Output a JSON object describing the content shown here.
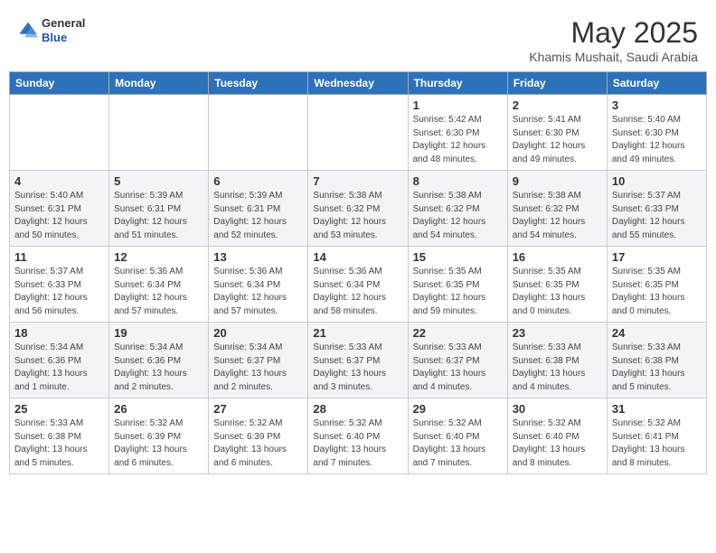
{
  "header": {
    "logo_general": "General",
    "logo_blue": "Blue",
    "month": "May 2025",
    "location": "Khamis Mushait, Saudi Arabia"
  },
  "weekdays": [
    "Sunday",
    "Monday",
    "Tuesday",
    "Wednesday",
    "Thursday",
    "Friday",
    "Saturday"
  ],
  "weeks": [
    [
      {
        "day": "",
        "info": ""
      },
      {
        "day": "",
        "info": ""
      },
      {
        "day": "",
        "info": ""
      },
      {
        "day": "",
        "info": ""
      },
      {
        "day": "1",
        "info": "Sunrise: 5:42 AM\nSunset: 6:30 PM\nDaylight: 12 hours\nand 48 minutes."
      },
      {
        "day": "2",
        "info": "Sunrise: 5:41 AM\nSunset: 6:30 PM\nDaylight: 12 hours\nand 49 minutes."
      },
      {
        "day": "3",
        "info": "Sunrise: 5:40 AM\nSunset: 6:30 PM\nDaylight: 12 hours\nand 49 minutes."
      }
    ],
    [
      {
        "day": "4",
        "info": "Sunrise: 5:40 AM\nSunset: 6:31 PM\nDaylight: 12 hours\nand 50 minutes."
      },
      {
        "day": "5",
        "info": "Sunrise: 5:39 AM\nSunset: 6:31 PM\nDaylight: 12 hours\nand 51 minutes."
      },
      {
        "day": "6",
        "info": "Sunrise: 5:39 AM\nSunset: 6:31 PM\nDaylight: 12 hours\nand 52 minutes."
      },
      {
        "day": "7",
        "info": "Sunrise: 5:38 AM\nSunset: 6:32 PM\nDaylight: 12 hours\nand 53 minutes."
      },
      {
        "day": "8",
        "info": "Sunrise: 5:38 AM\nSunset: 6:32 PM\nDaylight: 12 hours\nand 54 minutes."
      },
      {
        "day": "9",
        "info": "Sunrise: 5:38 AM\nSunset: 6:32 PM\nDaylight: 12 hours\nand 54 minutes."
      },
      {
        "day": "10",
        "info": "Sunrise: 5:37 AM\nSunset: 6:33 PM\nDaylight: 12 hours\nand 55 minutes."
      }
    ],
    [
      {
        "day": "11",
        "info": "Sunrise: 5:37 AM\nSunset: 6:33 PM\nDaylight: 12 hours\nand 56 minutes."
      },
      {
        "day": "12",
        "info": "Sunrise: 5:36 AM\nSunset: 6:34 PM\nDaylight: 12 hours\nand 57 minutes."
      },
      {
        "day": "13",
        "info": "Sunrise: 5:36 AM\nSunset: 6:34 PM\nDaylight: 12 hours\nand 57 minutes."
      },
      {
        "day": "14",
        "info": "Sunrise: 5:36 AM\nSunset: 6:34 PM\nDaylight: 12 hours\nand 58 minutes."
      },
      {
        "day": "15",
        "info": "Sunrise: 5:35 AM\nSunset: 6:35 PM\nDaylight: 12 hours\nand 59 minutes."
      },
      {
        "day": "16",
        "info": "Sunrise: 5:35 AM\nSunset: 6:35 PM\nDaylight: 13 hours\nand 0 minutes."
      },
      {
        "day": "17",
        "info": "Sunrise: 5:35 AM\nSunset: 6:35 PM\nDaylight: 13 hours\nand 0 minutes."
      }
    ],
    [
      {
        "day": "18",
        "info": "Sunrise: 5:34 AM\nSunset: 6:36 PM\nDaylight: 13 hours\nand 1 minute."
      },
      {
        "day": "19",
        "info": "Sunrise: 5:34 AM\nSunset: 6:36 PM\nDaylight: 13 hours\nand 2 minutes."
      },
      {
        "day": "20",
        "info": "Sunrise: 5:34 AM\nSunset: 6:37 PM\nDaylight: 13 hours\nand 2 minutes."
      },
      {
        "day": "21",
        "info": "Sunrise: 5:33 AM\nSunset: 6:37 PM\nDaylight: 13 hours\nand 3 minutes."
      },
      {
        "day": "22",
        "info": "Sunrise: 5:33 AM\nSunset: 6:37 PM\nDaylight: 13 hours\nand 4 minutes."
      },
      {
        "day": "23",
        "info": "Sunrise: 5:33 AM\nSunset: 6:38 PM\nDaylight: 13 hours\nand 4 minutes."
      },
      {
        "day": "24",
        "info": "Sunrise: 5:33 AM\nSunset: 6:38 PM\nDaylight: 13 hours\nand 5 minutes."
      }
    ],
    [
      {
        "day": "25",
        "info": "Sunrise: 5:33 AM\nSunset: 6:38 PM\nDaylight: 13 hours\nand 5 minutes."
      },
      {
        "day": "26",
        "info": "Sunrise: 5:32 AM\nSunset: 6:39 PM\nDaylight: 13 hours\nand 6 minutes."
      },
      {
        "day": "27",
        "info": "Sunrise: 5:32 AM\nSunset: 6:39 PM\nDaylight: 13 hours\nand 6 minutes."
      },
      {
        "day": "28",
        "info": "Sunrise: 5:32 AM\nSunset: 6:40 PM\nDaylight: 13 hours\nand 7 minutes."
      },
      {
        "day": "29",
        "info": "Sunrise: 5:32 AM\nSunset: 6:40 PM\nDaylight: 13 hours\nand 7 minutes."
      },
      {
        "day": "30",
        "info": "Sunrise: 5:32 AM\nSunset: 6:40 PM\nDaylight: 13 hours\nand 8 minutes."
      },
      {
        "day": "31",
        "info": "Sunrise: 5:32 AM\nSunset: 6:41 PM\nDaylight: 13 hours\nand 8 minutes."
      }
    ]
  ]
}
